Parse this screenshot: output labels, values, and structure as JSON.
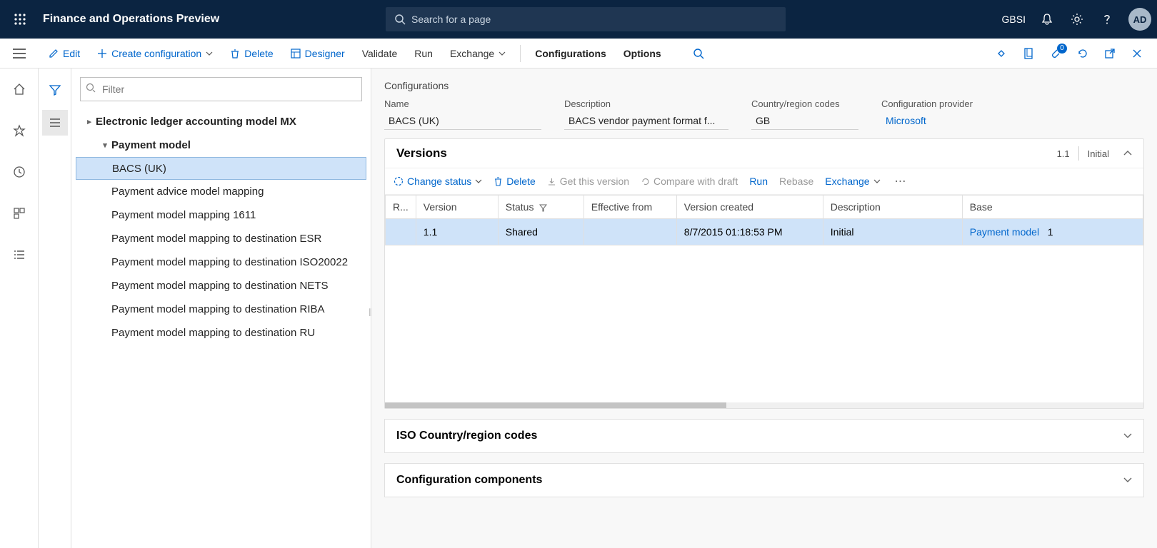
{
  "header": {
    "app_title": "Finance and Operations Preview",
    "search_placeholder": "Search for a page",
    "company": "GBSI",
    "avatar": "AD"
  },
  "cmdbar": {
    "edit": "Edit",
    "create": "Create configuration",
    "delete": "Delete",
    "designer": "Designer",
    "validate": "Validate",
    "run": "Run",
    "exchange": "Exchange",
    "configurations": "Configurations",
    "options": "Options",
    "badge_count": "0"
  },
  "tree": {
    "filter_placeholder": "Filter",
    "items": [
      {
        "label": "Electronic ledger accounting model MX",
        "level": 0,
        "expanded": false
      },
      {
        "label": "Payment model",
        "level": 1,
        "expanded": true
      },
      {
        "label": "BACS (UK)",
        "level": 2,
        "selected": true
      },
      {
        "label": "Payment advice model mapping",
        "level": 2
      },
      {
        "label": "Payment model mapping 1611",
        "level": 2
      },
      {
        "label": "Payment model mapping to destination ESR",
        "level": 2
      },
      {
        "label": "Payment model mapping to destination ISO20022",
        "level": 2
      },
      {
        "label": "Payment model mapping to destination NETS",
        "level": 2
      },
      {
        "label": "Payment model mapping to destination RIBA",
        "level": 2
      },
      {
        "label": "Payment model mapping to destination RU",
        "level": 2
      }
    ]
  },
  "main": {
    "crumb": "Configurations",
    "fields": {
      "name_lbl": "Name",
      "name_val": "BACS (UK)",
      "desc_lbl": "Description",
      "desc_val": "BACS vendor payment format f...",
      "cc_lbl": "Country/region codes",
      "cc_val": "GB",
      "prov_lbl": "Configuration provider",
      "prov_val": "Microsoft"
    },
    "versions": {
      "title": "Versions",
      "hdr_version": "1.1",
      "hdr_status": "Initial",
      "toolbar": {
        "change_status": "Change status",
        "delete": "Delete",
        "get_version": "Get this version",
        "compare": "Compare with draft",
        "run": "Run",
        "rebase": "Rebase",
        "exchange": "Exchange"
      },
      "columns": {
        "r": "R...",
        "version": "Version",
        "status": "Status",
        "eff": "Effective from",
        "created": "Version created",
        "desc": "Description",
        "base": "Base"
      },
      "rows": [
        {
          "version": "1.1",
          "status": "Shared",
          "eff": "",
          "created": "8/7/2015 01:18:53 PM",
          "desc": "Initial",
          "base": "Payment model",
          "base_num": "1"
        }
      ]
    },
    "iso_title": "ISO Country/region codes",
    "components_title": "Configuration components"
  }
}
